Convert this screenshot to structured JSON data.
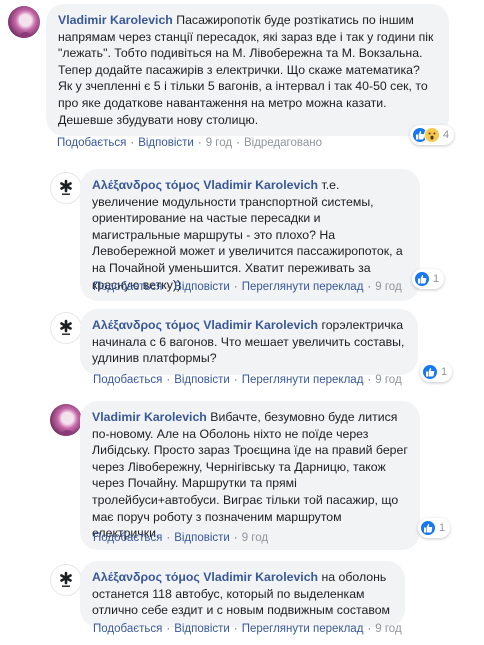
{
  "comments": [
    {
      "author": "Vladimir Karolevich",
      "mention": "",
      "text": "Пасажиропотік буде розтікатись по іншим напрямам через станції пересадок, які зараз вде і так у години пік \"лежать\". Тобто подивіться на М. Лівобережна та М. Вокзальна. Тепер додайте пасажирів з електрички. Що скаже математика? Як у зчепленні є 5 і тільки 5 вагонів, а інтервал і так 40-50 сек, то про яке додаткове навантаження на метро можна казати. Дешевше збудувати нову столицю.",
      "actions": {
        "like": "Подобається",
        "reply": "Відповісти",
        "time": "9 год",
        "extra": "Відредаговано"
      },
      "reactions": {
        "types": [
          "like",
          "wow"
        ],
        "count": "4"
      }
    },
    {
      "author": "Αλέξανδρος τόμος",
      "mention": "Vladimir Karolevich",
      "text": "т.е. увеличение модульности транспортной системы, ориентирование на частые пересадки и магистральные маршруты - это плохо? На Левобережной может и увеличится пассажиропоток, а на Почайной уменьшится. Хватит переживать за красную ветку))",
      "actions": {
        "like": "Подобається",
        "reply": "Відповісти",
        "extra": "Переглянути переклад",
        "time": "9 год"
      },
      "reactions": {
        "types": [
          "like"
        ],
        "count": "1"
      }
    },
    {
      "author": "Αλέξανδρος τόμος",
      "mention": "Vladimir Karolevich",
      "text": "горэлектричка начинала с 6 вагонов. Что мешает увеличить составы, удлинив платформы?",
      "actions": {
        "like": "Подобається",
        "reply": "Відповісти",
        "extra": "Переглянути переклад",
        "time": "9 год"
      },
      "reactions": {
        "types": [
          "like"
        ],
        "count": "1"
      }
    },
    {
      "author": "Vladimir Karolevich",
      "mention": "",
      "text": "Вибачте, безумовно буде литися по-новому. Але на Оболонь ніхто не поїде через Либідську. Просто зараз Троєщина їде на правий берег через Лівобережну, Чернігівську та Дарницю, також через Почайну. Маршрутки та прямі тролейбуси+автобуси. Виграє тільки той пасажир, що має поруч роботу з позначеним маршрутом електрички.",
      "actions": {
        "like": "Подобається",
        "reply": "Відповісти",
        "time": "9 год"
      },
      "reactions": {
        "types": [
          "like"
        ],
        "count": "1"
      }
    },
    {
      "author": "Αλέξανδρος τόμος",
      "mention": "Vladimir Karolevich",
      "text": "на оболонь останется 118 автобус, который по выделенкам отлично себе ездит и с новым подвижным составом",
      "actions": {
        "like": "Подобається",
        "reply": "Відповісти",
        "extra": "Переглянути переклад",
        "time": "9 год"
      },
      "reactions": {
        "types": [],
        "count": ""
      }
    }
  ],
  "colors": {
    "bubble": "#f2f3f5",
    "link": "#385898",
    "like": "#1877f2",
    "meta": "#616770"
  },
  "icons": {
    "like": "thumbs-up-icon",
    "wow": "wow-face-icon",
    "asterisk": "asterisk-avatar-icon"
  }
}
